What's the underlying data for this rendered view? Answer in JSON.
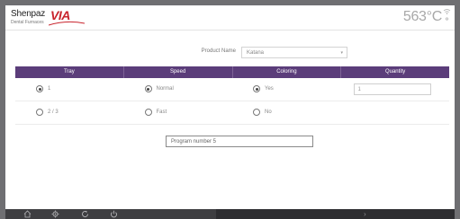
{
  "header": {
    "brand": "Shenpaz",
    "brand_suffix": "VIA",
    "tagline": "Dental Furnaces",
    "temperature": "563°C"
  },
  "product": {
    "label": "Product Name",
    "value": "Katana"
  },
  "table": {
    "columns": [
      "Tray",
      "Speed",
      "Coloring",
      "Quantity"
    ],
    "rows": [
      {
        "tray": "1",
        "tray_selected": true,
        "speed": "Normal",
        "speed_selected": true,
        "coloring": "Yes",
        "coloring_selected": true,
        "quantity": "1"
      },
      {
        "tray": "2 / 3",
        "tray_selected": false,
        "speed": "Fast",
        "speed_selected": false,
        "coloring": "No",
        "coloring_selected": false
      }
    ]
  },
  "program": {
    "label": "Program number",
    "value": "5",
    "text": "Program number  5"
  },
  "bottom_nav": {
    "icons": [
      "home-icon",
      "settings-icon",
      "cycle-icon",
      "power-icon",
      "next-arrow-icon"
    ],
    "next_glyph": "›"
  },
  "colors": {
    "header_purple": "#5b3d7a",
    "brand_red": "#c8232c",
    "bottom_bar": "#3e3e41"
  }
}
